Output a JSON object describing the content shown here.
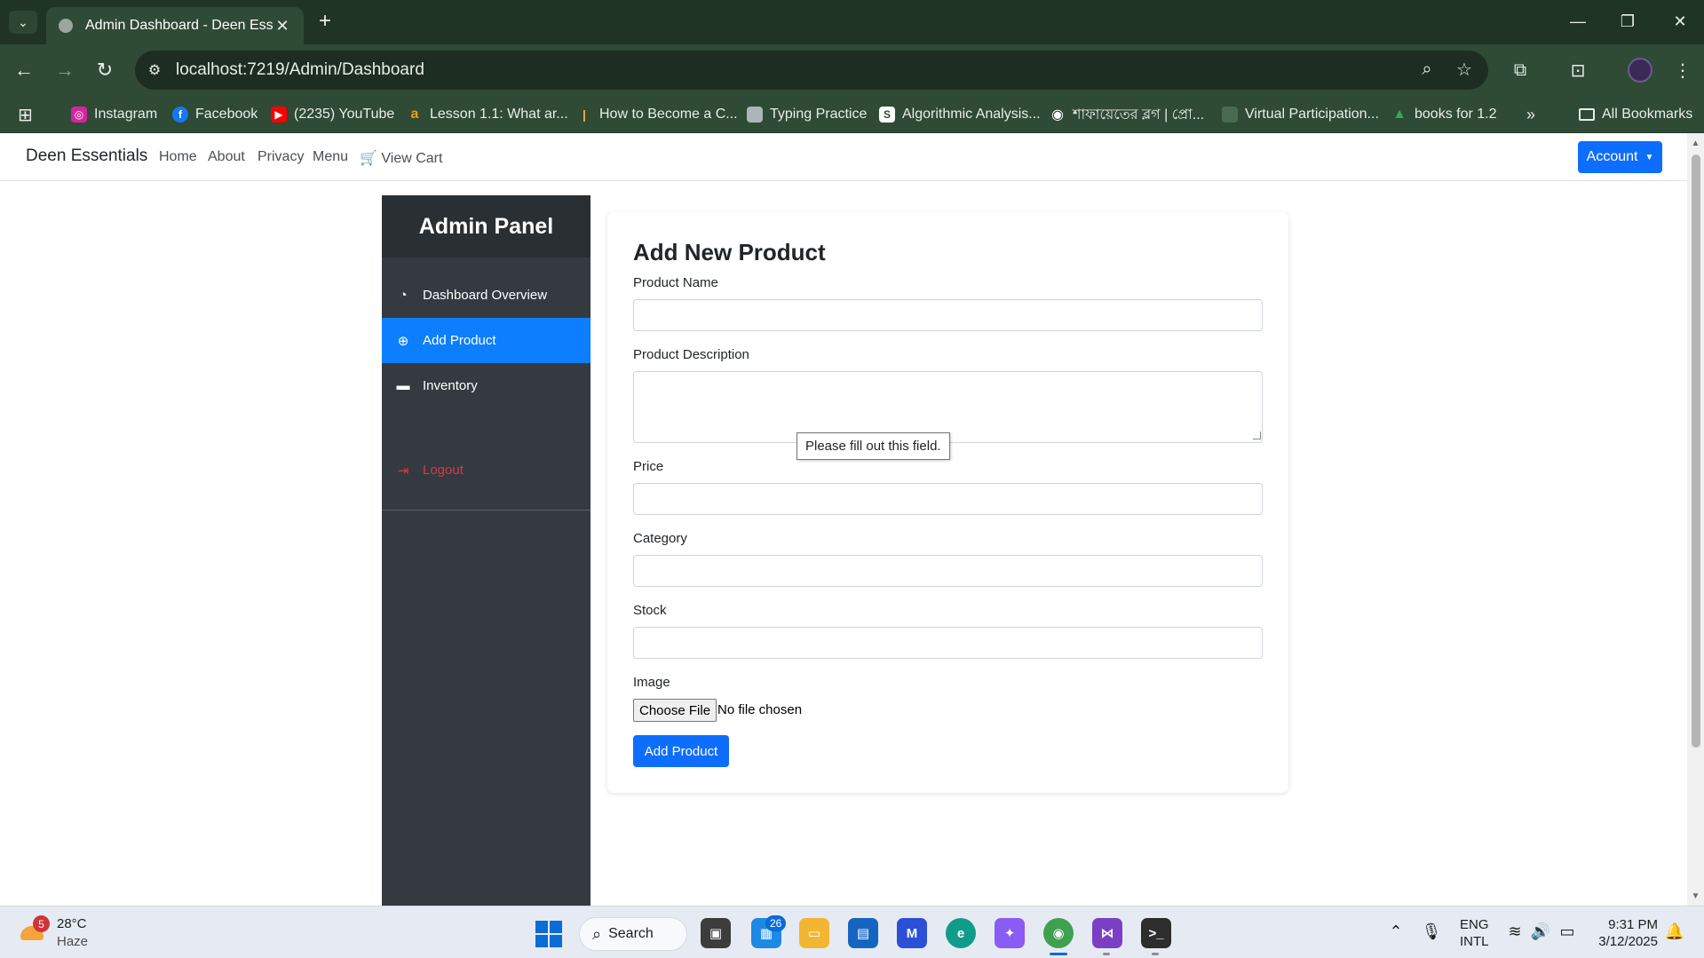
{
  "browser": {
    "tab_title": "Admin Dashboard - Deen Essen",
    "url": "localhost:7219/Admin/Dashboard",
    "bookmarks": [
      {
        "label": "Instagram",
        "icon": "instagram-icon",
        "color": "#d6249f"
      },
      {
        "label": "Facebook",
        "icon": "facebook-icon",
        "color": "#1877f2"
      },
      {
        "label": "(2235) YouTube",
        "icon": "youtube-icon",
        "color": "#ff0000"
      },
      {
        "label": "Lesson 1.1: What ar...",
        "icon": "lesson-icon",
        "color": "#f39c12"
      },
      {
        "label": "How to Become a C...",
        "icon": "bookmark-icon",
        "color": "#f5b041"
      },
      {
        "label": "Typing Practice",
        "icon": "typing-icon",
        "color": "#aab7b8"
      },
      {
        "label": "Algorithmic Analysis...",
        "icon": "algorithm-icon",
        "color": "#ffffff"
      },
      {
        "label": "শাফায়েতের ব্লগ | প্রো...",
        "icon": "blog-icon",
        "color": "#ffffff"
      },
      {
        "label": "Virtual Participation...",
        "icon": "participation-icon",
        "color": "#4a6b50"
      },
      {
        "label": "books for 1.2",
        "icon": "drive-icon",
        "color": "#34a853"
      }
    ],
    "all_bookmarks": "All Bookmarks"
  },
  "site": {
    "brand": "Deen Essentials",
    "nav": [
      "Home",
      "About",
      "Privacy",
      "Menu"
    ],
    "view_cart": "View Cart",
    "account": "Account"
  },
  "sidebar": {
    "title": "Admin Panel",
    "items": [
      {
        "label": "Dashboard Overview",
        "icon": "dashboard-icon",
        "active": false
      },
      {
        "label": "Add Product",
        "icon": "plus-circle-icon",
        "active": true
      },
      {
        "label": "Inventory",
        "icon": "box-icon",
        "active": false
      }
    ],
    "logout": "Logout"
  },
  "form": {
    "title": "Add New Product",
    "fields": {
      "name": {
        "label": "Product Name",
        "value": ""
      },
      "description": {
        "label": "Product Description",
        "value": ""
      },
      "price": {
        "label": "Price",
        "value": ""
      },
      "category": {
        "label": "Category",
        "value": ""
      },
      "stock": {
        "label": "Stock",
        "value": ""
      },
      "image": {
        "label": "Image",
        "button": "Choose File",
        "status": "No file chosen"
      }
    },
    "validation_tooltip": "Please fill out this field.",
    "submit": "Add Product"
  },
  "taskbar": {
    "weather": {
      "badge": "5",
      "temp": "28°C",
      "desc": "Haze"
    },
    "search": "Search",
    "store_badge": "26",
    "lang": [
      "ENG",
      "INTL"
    ],
    "time": "9:31 PM",
    "date": "3/12/2025"
  },
  "colors": {
    "accent": "#0d6efd",
    "sidebar_bg": "#343a40",
    "sidebar_active": "#0d7efd",
    "logout": "#dc3545",
    "chrome_bg": "#2f4a35"
  }
}
